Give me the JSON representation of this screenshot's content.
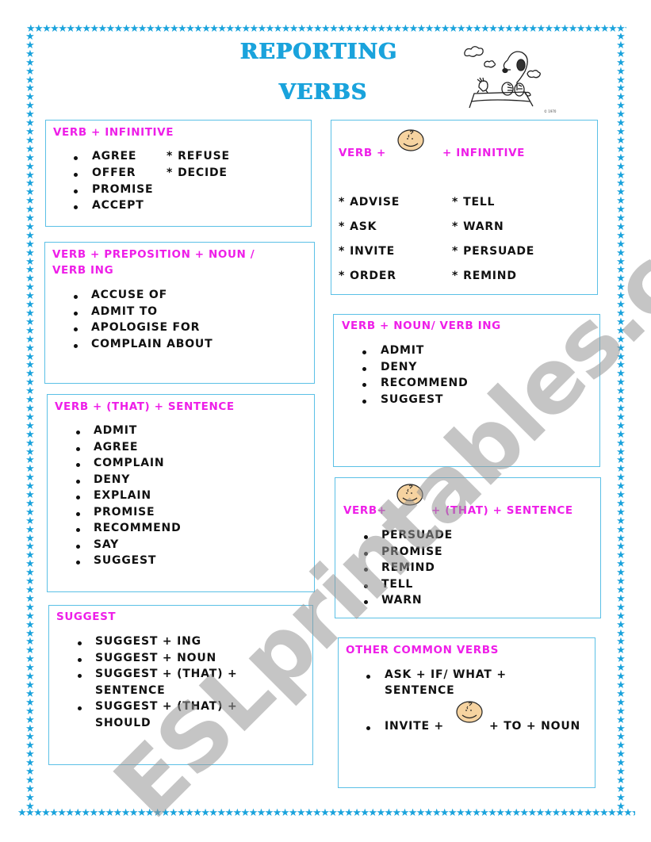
{
  "page": {
    "title_line1": "REPORTING",
    "title_line2": "VERBS",
    "colors": {
      "frame": "#1aa3dc",
      "heading": "#ee1ee8",
      "box_border": "#5bc0e6",
      "text": "#111111"
    },
    "frame_icon": "star-icon",
    "illustration": "snoopy-illustration",
    "watermark": "ESLprintables.com"
  },
  "boxes": {
    "verb_infinitive": {
      "heading": "VERB + INFINITIVE",
      "col1": [
        "AGREE",
        "OFFER",
        "PROMISE",
        "ACCEPT"
      ],
      "col2": [
        "REFUSE",
        "DECIDE"
      ],
      "star": "*"
    },
    "verb_person_infinitive": {
      "heading_pre": "VERB +",
      "heading_post": "+ INFINITIVE",
      "face_icon": "charlie-brown-face-icon",
      "col1": [
        "ADVISE",
        "ASK",
        "INVITE",
        "ORDER"
      ],
      "col2": [
        "TELL",
        "WARN",
        "PERSUADE",
        "REMIND"
      ],
      "star": "*"
    },
    "verb_preposition": {
      "heading_line1": "VERB + PREPOSITION + NOUN /",
      "heading_line2": "VERB ING",
      "items": [
        "ACCUSE OF",
        "ADMIT TO",
        "APOLOGISE FOR",
        "COMPLAIN ABOUT"
      ]
    },
    "verb_noun_ing": {
      "heading": "VERB + NOUN/ VERB ING",
      "items": [
        "ADMIT",
        "DENY",
        "RECOMMEND",
        "SUGGEST"
      ]
    },
    "verb_that_sentence": {
      "heading": "VERB + (THAT) + SENTENCE",
      "items": [
        "ADMIT",
        "AGREE",
        "COMPLAIN",
        "DENY",
        "EXPLAIN",
        "PROMISE",
        "RECOMMEND",
        "SAY",
        "SUGGEST"
      ]
    },
    "verb_person_that_sentence": {
      "heading_pre": "VERB+",
      "heading_post": "+ (THAT) + SENTENCE",
      "face_icon": "charlie-brown-face-icon",
      "items": [
        "PERSUADE",
        "PROMISE",
        "REMIND",
        "TELL",
        "WARN"
      ]
    },
    "suggest": {
      "heading": "SUGGEST",
      "items": [
        {
          "line1": "SUGGEST + ING"
        },
        {
          "line1": "SUGGEST + NOUN"
        },
        {
          "line1": "SUGGEST + (THAT) +",
          "line2": "SENTENCE"
        },
        {
          "line1": "SUGGEST + (THAT) +",
          "line2": "SHOULD"
        }
      ]
    },
    "other_common": {
      "heading": "OTHER COMMON VERBS",
      "item1_line1": "ASK + IF/ WHAT +",
      "item1_line2": "SENTENCE",
      "item2_pre": "INVITE +",
      "item2_post": "+ TO + NOUN",
      "face_icon": "charlie-brown-face-icon"
    }
  }
}
